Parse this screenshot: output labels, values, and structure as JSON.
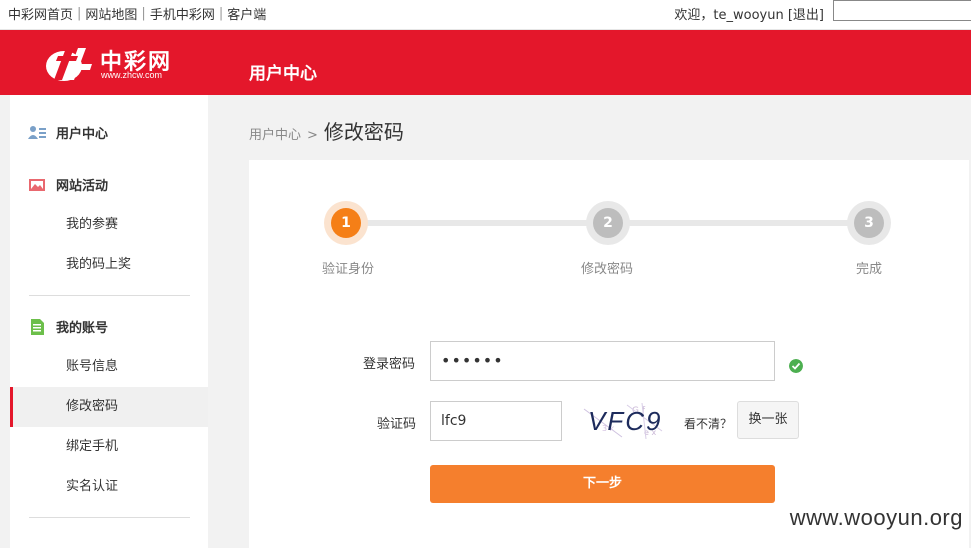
{
  "topbar": {
    "links": [
      "中彩网首页",
      "网站地图",
      "手机中彩网",
      "客户端"
    ],
    "welcome": "欢迎，te_wooyun",
    "logout": "[退出]"
  },
  "header": {
    "logo_cn": "中彩网",
    "logo_url": "www.zhcw.com",
    "title": "用户中心",
    "brand_color": "#e4172b"
  },
  "sidebar": {
    "user_center": "用户中心",
    "activities": "网站活动",
    "activity_items": [
      "我的参赛",
      "我的码上奖"
    ],
    "account": "我的账号",
    "account_items": [
      "账号信息",
      "修改密码",
      "绑定手机",
      "实名认证"
    ],
    "active_item": "修改密码"
  },
  "breadcrumb": {
    "parent": "用户中心",
    "separator": ">",
    "current": "修改密码"
  },
  "steps": [
    {
      "number": "1",
      "label": "验证身份",
      "active": true
    },
    {
      "number": "2",
      "label": "修改密码",
      "active": false
    },
    {
      "number": "3",
      "label": "完成",
      "active": false
    }
  ],
  "form": {
    "password_label": "登录密码",
    "password_value": "••••••",
    "captcha_label": "验证码",
    "captcha_value": "lfc9",
    "captcha_image_text": "VFC9",
    "unclear": "看不清？",
    "refresh": "换一张",
    "next": "下一步",
    "accent_color": "#f57f2d"
  },
  "watermark": "www.wooyun.org"
}
